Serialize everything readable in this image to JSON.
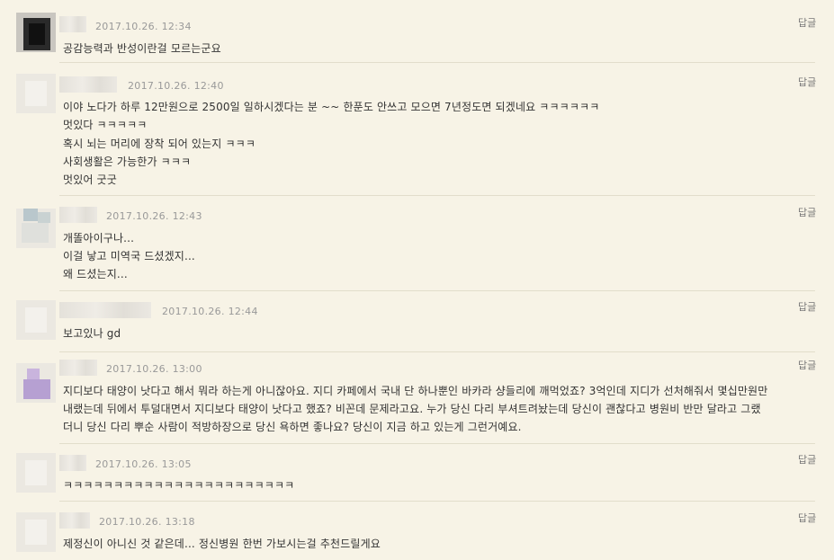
{
  "reply_label": "답글",
  "comments": [
    {
      "date": "2017.10.26. 12:34",
      "lines": [
        "공감능력과 반성이란걸 모르는군요"
      ]
    },
    {
      "date": "2017.10.26. 12:40",
      "lines": [
        "이야 노다가 하루 12만원으로 2500일 일하시겠다는 분 ~~ 한푼도 안쓰고 모으면 7년정도면 되겠네요 ㅋㅋㅋㅋㅋㅋ",
        "멋있다 ㅋㅋㅋㅋㅋ",
        "혹시 뇌는 머리에 장착 되어 있는지 ㅋㅋㅋ",
        "사회생활은 가능한가 ㅋㅋㅋ",
        "멋있어 굿굿"
      ]
    },
    {
      "date": "2017.10.26. 12:43",
      "lines": [
        "개똘아이구나...",
        "이걸 낳고 미역국 드셨겠지...",
        "왜 드셨는지..."
      ]
    },
    {
      "date": "2017.10.26. 12:44",
      "lines": [
        "보고있나 gd"
      ]
    },
    {
      "date": "2017.10.26. 13:00",
      "lines": [
        "지디보다 태양이 낫다고 해서 뭐라 하는게 아니잖아요. 지디 카페에서 국내 단 하나뿐인 바카라 샹들리에 깨먹었죠? 3억인데 지디가 선처해줘서 몇십만원만",
        "내랬는데 뒤에서 투덜대면서 지디보다 태양이 낫다고 했죠? 비꼰데 문제라고요. 누가 당신 다리 부셔트려놨는데 당신이 괜찮다고 병원비 반만 달라고 그랬",
        "더니 당신 다리 뿌순 사람이 적방하장으로 당신 욕하면 좋나요? 당신이 지금 하고 있는게 그런거예요."
      ]
    },
    {
      "date": "2017.10.26. 13:05",
      "lines": [
        "ㅋㅋㅋㅋㅋㅋㅋㅋㅋㅋㅋㅋㅋㅋㅋㅋㅋㅋㅋㅋㅋㅋㅋ"
      ]
    },
    {
      "date": "2017.10.26. 13:18",
      "lines": [
        "제정신이 아니신 것 같은데... 정신병원 한번 가보시는걸 추천드릴게요"
      ]
    }
  ]
}
